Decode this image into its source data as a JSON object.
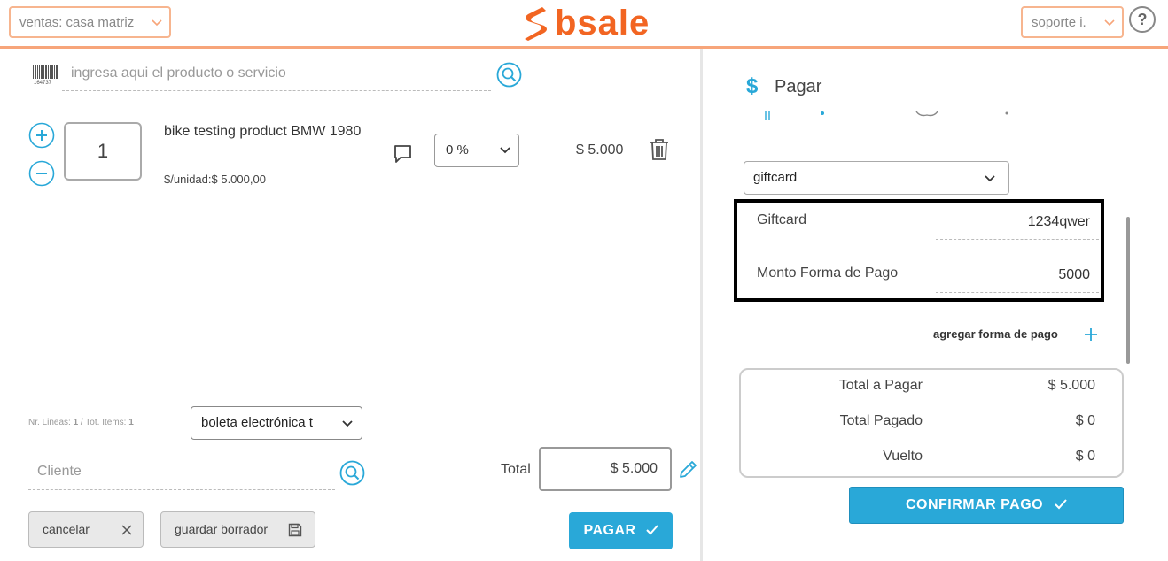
{
  "header": {
    "branch_select": "ventas: casa matriz",
    "logo_text": "bsale",
    "user_select": "soporte i.",
    "help_label": "?"
  },
  "search": {
    "placeholder": "ingresa aqui el producto o servicio",
    "barcode_text": "164737"
  },
  "line_item": {
    "quantity": "1",
    "product_name": "bike testing product BMW 1980",
    "unit_price": "$/unidad:$ 5.000,00",
    "discount": "0 %",
    "price": "$ 5.000"
  },
  "footer_left": {
    "counts_prefix": "Nr. Lineas: ",
    "lines": "1",
    "counts_mid": " / Tot. Items: ",
    "items": "1",
    "document_type": "boleta electrónica t",
    "client_placeholder": "Cliente",
    "total_label": "Total",
    "total_value": "$ 5.000",
    "cancel_label": "cancelar",
    "draft_label": "guardar borrador",
    "pay_label": "PAGAR"
  },
  "payment": {
    "title": "Pagar",
    "method_select": "giftcard",
    "giftcard_label": "Giftcard",
    "giftcard_value": "1234qwer",
    "amount_label": "Monto Forma de Pago",
    "amount_value": "5000",
    "add_method_label": "agregar forma de pago",
    "summary": [
      {
        "label": "Total a Pagar",
        "value": "$ 5.000"
      },
      {
        "label": "Total Pagado",
        "value": "$ 0"
      },
      {
        "label": "Vuelto",
        "value": "$ 0"
      }
    ],
    "confirm_label": "CONFIRMAR PAGO"
  },
  "colors": {
    "accent": "#29a8d8",
    "brand": "#f26522"
  }
}
